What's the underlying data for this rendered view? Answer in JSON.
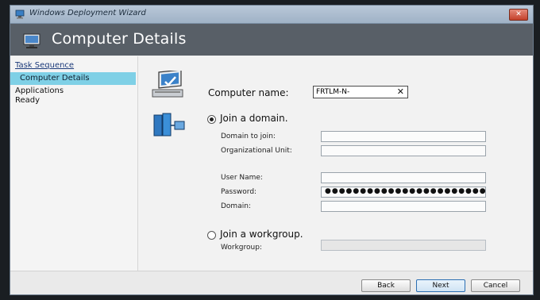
{
  "window": {
    "title": "Windows Deployment Wizard",
    "close_label": "✕"
  },
  "header": {
    "title": "Computer Details"
  },
  "sidebar": {
    "items": [
      {
        "label": "Task Sequence"
      },
      {
        "label": "Computer Details"
      },
      {
        "label": "Applications"
      },
      {
        "label": "Ready"
      }
    ]
  },
  "form": {
    "computer_name": {
      "label": "Computer name:",
      "value": "FRTLM-N-",
      "clear_icon": "✕"
    },
    "join_domain": {
      "label": "Join a domain.",
      "selected": true
    },
    "domain_to_join": {
      "label": "Domain to join:",
      "value": ""
    },
    "organizational_unit": {
      "label": "Organizational Unit:",
      "value": ""
    },
    "user_name": {
      "label": "User Name:",
      "value": ""
    },
    "password": {
      "label": "Password:",
      "value": "●●●●●●●●●●●●●●●●●●●●●●●●●●●●●"
    },
    "domain": {
      "label": "Domain:",
      "value": ""
    },
    "join_workgroup": {
      "label": "Join a workgroup.",
      "selected": false
    },
    "workgroup": {
      "label": "Workgroup:",
      "value": ""
    }
  },
  "footer": {
    "back_label": "Back",
    "next_label": "Next",
    "cancel_label": "Cancel"
  },
  "colors": {
    "header_bg": "#585f67",
    "selected_nav": "#7fd0e6"
  }
}
